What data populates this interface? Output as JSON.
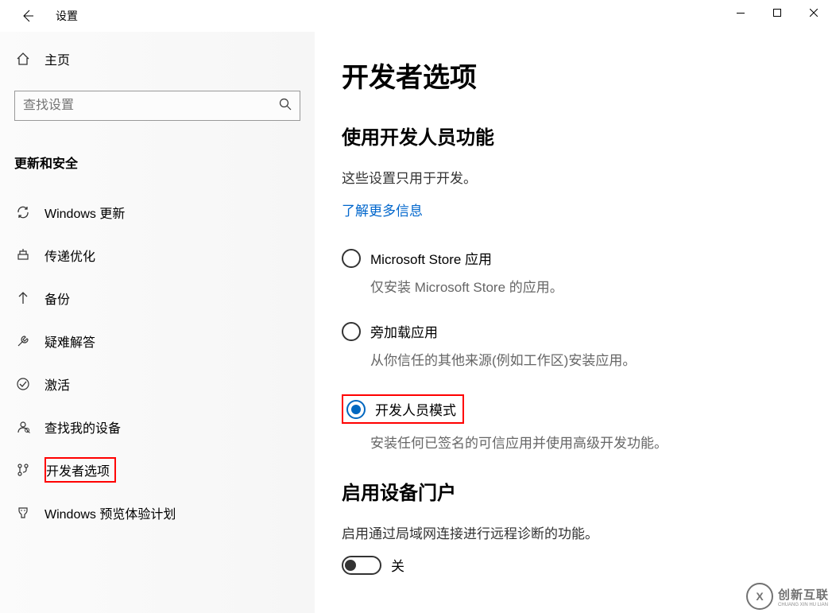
{
  "window": {
    "title": "设置"
  },
  "sidebar": {
    "home_label": "主页",
    "search_placeholder": "查找设置",
    "section_header": "更新和安全",
    "items": [
      {
        "icon": "sync",
        "label": "Windows 更新"
      },
      {
        "icon": "delivery",
        "label": "传递优化"
      },
      {
        "icon": "backup",
        "label": "备份"
      },
      {
        "icon": "troubleshoot",
        "label": "疑难解答"
      },
      {
        "icon": "activation",
        "label": "激活"
      },
      {
        "icon": "findmydevice",
        "label": "查找我的设备"
      },
      {
        "icon": "developer",
        "label": "开发者选项",
        "selected": true
      },
      {
        "icon": "insider",
        "label": "Windows 预览体验计划"
      }
    ]
  },
  "main": {
    "page_title": "开发者选项",
    "section1_title": "使用开发人员功能",
    "section1_info": "这些设置只用于开发。",
    "section1_link": "了解更多信息",
    "radio_options": [
      {
        "label": "Microsoft Store 应用",
        "desc": "仅安装 Microsoft Store 的应用。",
        "selected": false
      },
      {
        "label": "旁加载应用",
        "desc": "从你信任的其他来源(例如工作区)安装应用。",
        "selected": false
      },
      {
        "label": "开发人员模式",
        "desc": "安装任何已签名的可信应用并使用高级开发功能。",
        "selected": true,
        "highlighted": true
      }
    ],
    "section2_title": "启用设备门户",
    "section2_info": "启用通过局域网连接进行远程诊断的功能。",
    "toggle_state": "off",
    "toggle_label": "关"
  },
  "watermark": {
    "logo_text": "X",
    "text": "创新互联",
    "sub": "CHUANG XIN HU LIAN"
  }
}
